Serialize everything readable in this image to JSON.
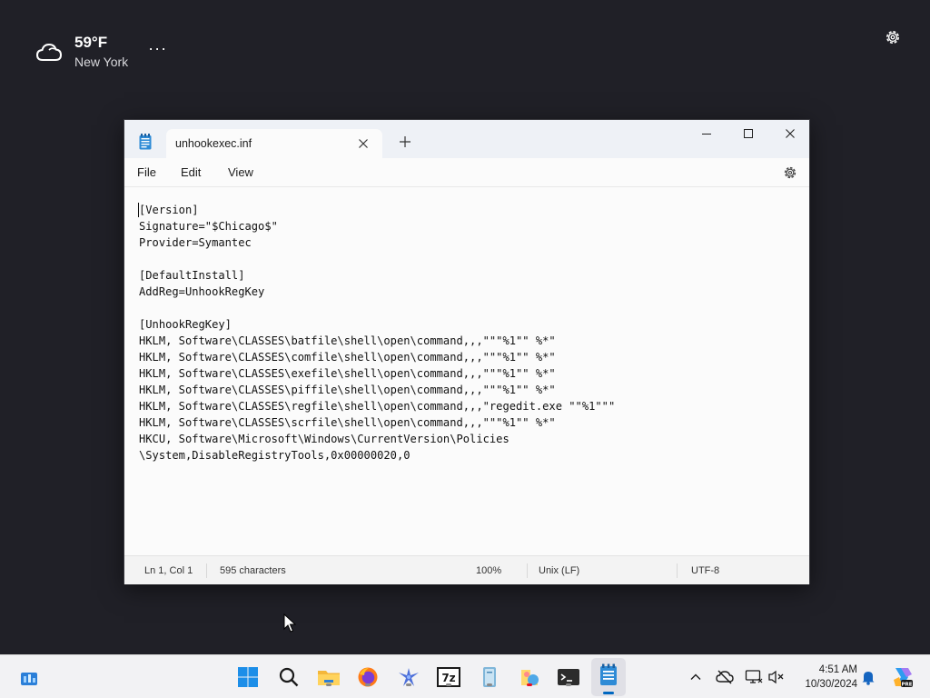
{
  "desktop": {
    "weather": {
      "temperature": "59°F",
      "location": "New York",
      "icon": "cloud-icon",
      "more_label": "···"
    },
    "settings_icon": "gear-icon"
  },
  "notepad": {
    "tab": {
      "title": "unhookexec.inf",
      "close_label": "✕"
    },
    "new_tab_label": "+",
    "window_controls": {
      "minimize": "minimize-icon",
      "maximize": "maximize-icon",
      "close": "close-icon"
    },
    "menu": {
      "file": "File",
      "edit": "Edit",
      "view": "View"
    },
    "content": "[Version]\nSignature=\"$Chicago$\"\nProvider=Symantec\n\n[DefaultInstall]\nAddReg=UnhookRegKey\n\n[UnhookRegKey]\nHKLM, Software\\CLASSES\\batfile\\shell\\open\\command,,,\"\"\"%1\"\" %*\"\nHKLM, Software\\CLASSES\\comfile\\shell\\open\\command,,,\"\"\"%1\"\" %*\"\nHKLM, Software\\CLASSES\\exefile\\shell\\open\\command,,,\"\"\"%1\"\" %*\"\nHKLM, Software\\CLASSES\\piffile\\shell\\open\\command,,,\"\"\"%1\"\" %*\"\nHKLM, Software\\CLASSES\\regfile\\shell\\open\\command,,,\"regedit.exe \"\"%1\"\"\"\nHKLM, Software\\CLASSES\\scrfile\\shell\\open\\command,,,\"\"\"%1\"\" %*\"\nHKCU, Software\\Microsoft\\Windows\\CurrentVersion\\Policies\n\\System,DisableRegistryTools,0x00000020,0",
    "status": {
      "position": "Ln 1, Col 1",
      "characters": "595 characters",
      "zoom": "100%",
      "line_endings": "Unix (LF)",
      "encoding": "UTF-8"
    }
  },
  "taskbar": {
    "apps": [
      {
        "name": "widgets-icon"
      },
      {
        "name": "start-icon"
      },
      {
        "name": "search-icon"
      },
      {
        "name": "file-explorer-icon"
      },
      {
        "name": "firefox-icon"
      },
      {
        "name": "bird-app-icon"
      },
      {
        "name": "7zip-icon",
        "label": "7z"
      },
      {
        "name": "notebook-app-icon"
      },
      {
        "name": "paint-app-icon"
      },
      {
        "name": "terminal-icon"
      },
      {
        "name": "notepad-icon"
      }
    ],
    "tray": {
      "chevron": "chevron-up-icon",
      "cloud_offline": "cloud-offline-icon",
      "network": "network-icon",
      "volume": "volume-muted-icon",
      "bell": "bell-icon",
      "copilot": "copilot-icon",
      "copilot_badge": "PRE"
    },
    "clock": {
      "time": "4:51 AM",
      "date": "10/30/2024"
    }
  }
}
